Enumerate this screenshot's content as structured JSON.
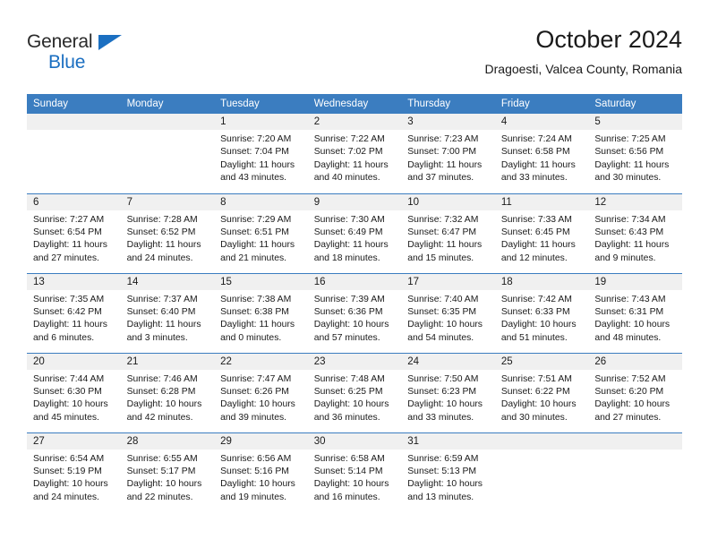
{
  "brand": {
    "name_part1": "General",
    "name_part2": "Blue",
    "accent_color": "#1b6fc1"
  },
  "header": {
    "title": "October 2024",
    "subtitle": "Dragoesti, Valcea County, Romania"
  },
  "calendar": {
    "header_bg": "#3b7dc0",
    "daynum_bg": "#f0f0f0",
    "weekday_names": [
      "Sunday",
      "Monday",
      "Tuesday",
      "Wednesday",
      "Thursday",
      "Friday",
      "Saturday"
    ],
    "labels": {
      "sunrise": "Sunrise:",
      "sunset": "Sunset:",
      "daylight": "Daylight:"
    },
    "weeks": [
      [
        {
          "day": "",
          "empty": true
        },
        {
          "day": "",
          "empty": true
        },
        {
          "day": "1",
          "sunrise": "Sunrise: 7:20 AM",
          "sunset": "Sunset: 7:04 PM",
          "daylight_1": "Daylight: 11 hours",
          "daylight_2": "and 43 minutes."
        },
        {
          "day": "2",
          "sunrise": "Sunrise: 7:22 AM",
          "sunset": "Sunset: 7:02 PM",
          "daylight_1": "Daylight: 11 hours",
          "daylight_2": "and 40 minutes."
        },
        {
          "day": "3",
          "sunrise": "Sunrise: 7:23 AM",
          "sunset": "Sunset: 7:00 PM",
          "daylight_1": "Daylight: 11 hours",
          "daylight_2": "and 37 minutes."
        },
        {
          "day": "4",
          "sunrise": "Sunrise: 7:24 AM",
          "sunset": "Sunset: 6:58 PM",
          "daylight_1": "Daylight: 11 hours",
          "daylight_2": "and 33 minutes."
        },
        {
          "day": "5",
          "sunrise": "Sunrise: 7:25 AM",
          "sunset": "Sunset: 6:56 PM",
          "daylight_1": "Daylight: 11 hours",
          "daylight_2": "and 30 minutes."
        }
      ],
      [
        {
          "day": "6",
          "sunrise": "Sunrise: 7:27 AM",
          "sunset": "Sunset: 6:54 PM",
          "daylight_1": "Daylight: 11 hours",
          "daylight_2": "and 27 minutes."
        },
        {
          "day": "7",
          "sunrise": "Sunrise: 7:28 AM",
          "sunset": "Sunset: 6:52 PM",
          "daylight_1": "Daylight: 11 hours",
          "daylight_2": "and 24 minutes."
        },
        {
          "day": "8",
          "sunrise": "Sunrise: 7:29 AM",
          "sunset": "Sunset: 6:51 PM",
          "daylight_1": "Daylight: 11 hours",
          "daylight_2": "and 21 minutes."
        },
        {
          "day": "9",
          "sunrise": "Sunrise: 7:30 AM",
          "sunset": "Sunset: 6:49 PM",
          "daylight_1": "Daylight: 11 hours",
          "daylight_2": "and 18 minutes."
        },
        {
          "day": "10",
          "sunrise": "Sunrise: 7:32 AM",
          "sunset": "Sunset: 6:47 PM",
          "daylight_1": "Daylight: 11 hours",
          "daylight_2": "and 15 minutes."
        },
        {
          "day": "11",
          "sunrise": "Sunrise: 7:33 AM",
          "sunset": "Sunset: 6:45 PM",
          "daylight_1": "Daylight: 11 hours",
          "daylight_2": "and 12 minutes."
        },
        {
          "day": "12",
          "sunrise": "Sunrise: 7:34 AM",
          "sunset": "Sunset: 6:43 PM",
          "daylight_1": "Daylight: 11 hours",
          "daylight_2": "and 9 minutes."
        }
      ],
      [
        {
          "day": "13",
          "sunrise": "Sunrise: 7:35 AM",
          "sunset": "Sunset: 6:42 PM",
          "daylight_1": "Daylight: 11 hours",
          "daylight_2": "and 6 minutes."
        },
        {
          "day": "14",
          "sunrise": "Sunrise: 7:37 AM",
          "sunset": "Sunset: 6:40 PM",
          "daylight_1": "Daylight: 11 hours",
          "daylight_2": "and 3 minutes."
        },
        {
          "day": "15",
          "sunrise": "Sunrise: 7:38 AM",
          "sunset": "Sunset: 6:38 PM",
          "daylight_1": "Daylight: 11 hours",
          "daylight_2": "and 0 minutes."
        },
        {
          "day": "16",
          "sunrise": "Sunrise: 7:39 AM",
          "sunset": "Sunset: 6:36 PM",
          "daylight_1": "Daylight: 10 hours",
          "daylight_2": "and 57 minutes."
        },
        {
          "day": "17",
          "sunrise": "Sunrise: 7:40 AM",
          "sunset": "Sunset: 6:35 PM",
          "daylight_1": "Daylight: 10 hours",
          "daylight_2": "and 54 minutes."
        },
        {
          "day": "18",
          "sunrise": "Sunrise: 7:42 AM",
          "sunset": "Sunset: 6:33 PM",
          "daylight_1": "Daylight: 10 hours",
          "daylight_2": "and 51 minutes."
        },
        {
          "day": "19",
          "sunrise": "Sunrise: 7:43 AM",
          "sunset": "Sunset: 6:31 PM",
          "daylight_1": "Daylight: 10 hours",
          "daylight_2": "and 48 minutes."
        }
      ],
      [
        {
          "day": "20",
          "sunrise": "Sunrise: 7:44 AM",
          "sunset": "Sunset: 6:30 PM",
          "daylight_1": "Daylight: 10 hours",
          "daylight_2": "and 45 minutes."
        },
        {
          "day": "21",
          "sunrise": "Sunrise: 7:46 AM",
          "sunset": "Sunset: 6:28 PM",
          "daylight_1": "Daylight: 10 hours",
          "daylight_2": "and 42 minutes."
        },
        {
          "day": "22",
          "sunrise": "Sunrise: 7:47 AM",
          "sunset": "Sunset: 6:26 PM",
          "daylight_1": "Daylight: 10 hours",
          "daylight_2": "and 39 minutes."
        },
        {
          "day": "23",
          "sunrise": "Sunrise: 7:48 AM",
          "sunset": "Sunset: 6:25 PM",
          "daylight_1": "Daylight: 10 hours",
          "daylight_2": "and 36 minutes."
        },
        {
          "day": "24",
          "sunrise": "Sunrise: 7:50 AM",
          "sunset": "Sunset: 6:23 PM",
          "daylight_1": "Daylight: 10 hours",
          "daylight_2": "and 33 minutes."
        },
        {
          "day": "25",
          "sunrise": "Sunrise: 7:51 AM",
          "sunset": "Sunset: 6:22 PM",
          "daylight_1": "Daylight: 10 hours",
          "daylight_2": "and 30 minutes."
        },
        {
          "day": "26",
          "sunrise": "Sunrise: 7:52 AM",
          "sunset": "Sunset: 6:20 PM",
          "daylight_1": "Daylight: 10 hours",
          "daylight_2": "and 27 minutes."
        }
      ],
      [
        {
          "day": "27",
          "sunrise": "Sunrise: 6:54 AM",
          "sunset": "Sunset: 5:19 PM",
          "daylight_1": "Daylight: 10 hours",
          "daylight_2": "and 24 minutes."
        },
        {
          "day": "28",
          "sunrise": "Sunrise: 6:55 AM",
          "sunset": "Sunset: 5:17 PM",
          "daylight_1": "Daylight: 10 hours",
          "daylight_2": "and 22 minutes."
        },
        {
          "day": "29",
          "sunrise": "Sunrise: 6:56 AM",
          "sunset": "Sunset: 5:16 PM",
          "daylight_1": "Daylight: 10 hours",
          "daylight_2": "and 19 minutes."
        },
        {
          "day": "30",
          "sunrise": "Sunrise: 6:58 AM",
          "sunset": "Sunset: 5:14 PM",
          "daylight_1": "Daylight: 10 hours",
          "daylight_2": "and 16 minutes."
        },
        {
          "day": "31",
          "sunrise": "Sunrise: 6:59 AM",
          "sunset": "Sunset: 5:13 PM",
          "daylight_1": "Daylight: 10 hours",
          "daylight_2": "and 13 minutes."
        },
        {
          "day": "",
          "empty": true
        },
        {
          "day": "",
          "empty": true
        }
      ]
    ]
  }
}
